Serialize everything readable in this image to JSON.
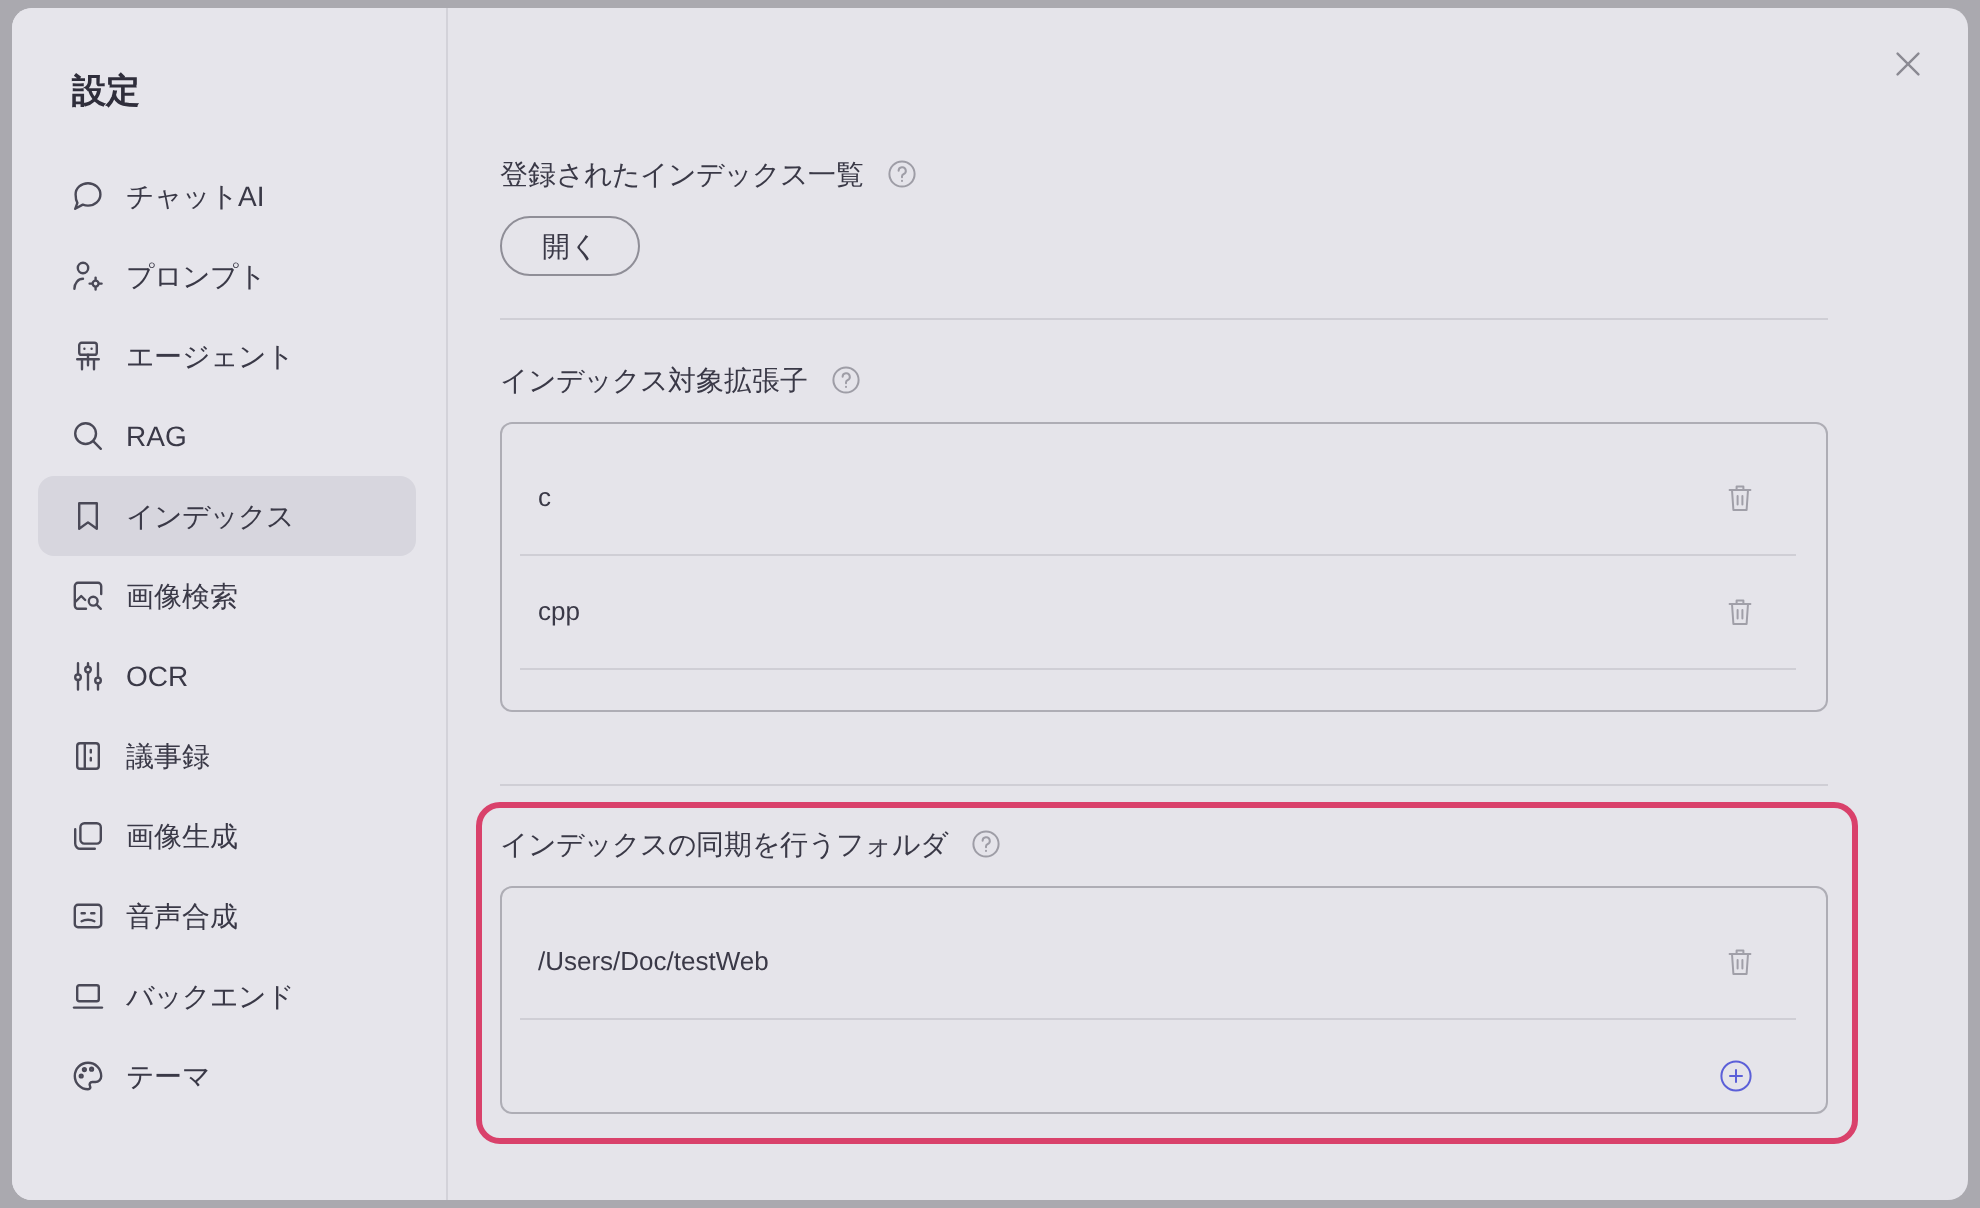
{
  "sidebar": {
    "title": "設定",
    "items": [
      {
        "label": "チャットAI",
        "selected": false
      },
      {
        "label": "プロンプト",
        "selected": false
      },
      {
        "label": "エージェント",
        "selected": false
      },
      {
        "label": "RAG",
        "selected": false
      },
      {
        "label": "インデックス",
        "selected": true
      },
      {
        "label": "画像検索",
        "selected": false
      },
      {
        "label": "OCR",
        "selected": false
      },
      {
        "label": "議事録",
        "selected": false
      },
      {
        "label": "画像生成",
        "selected": false
      },
      {
        "label": "音声合成",
        "selected": false
      },
      {
        "label": "バックエンド",
        "selected": false
      },
      {
        "label": "テーマ",
        "selected": false
      }
    ]
  },
  "sections": [
    {
      "kind": "button",
      "title": "登録されたインデックス一覧",
      "highlighted": false,
      "button": "開く"
    },
    {
      "kind": "list",
      "title": "インデックス対象拡張子",
      "highlighted": false,
      "items": [
        "c",
        "cpp"
      ],
      "addable": false
    },
    {
      "kind": "list",
      "title": "インデックスの同期を行うフォルダ",
      "highlighted": true,
      "items": [
        "/Users/Doc/testWeb"
      ],
      "addable": true
    }
  ]
}
